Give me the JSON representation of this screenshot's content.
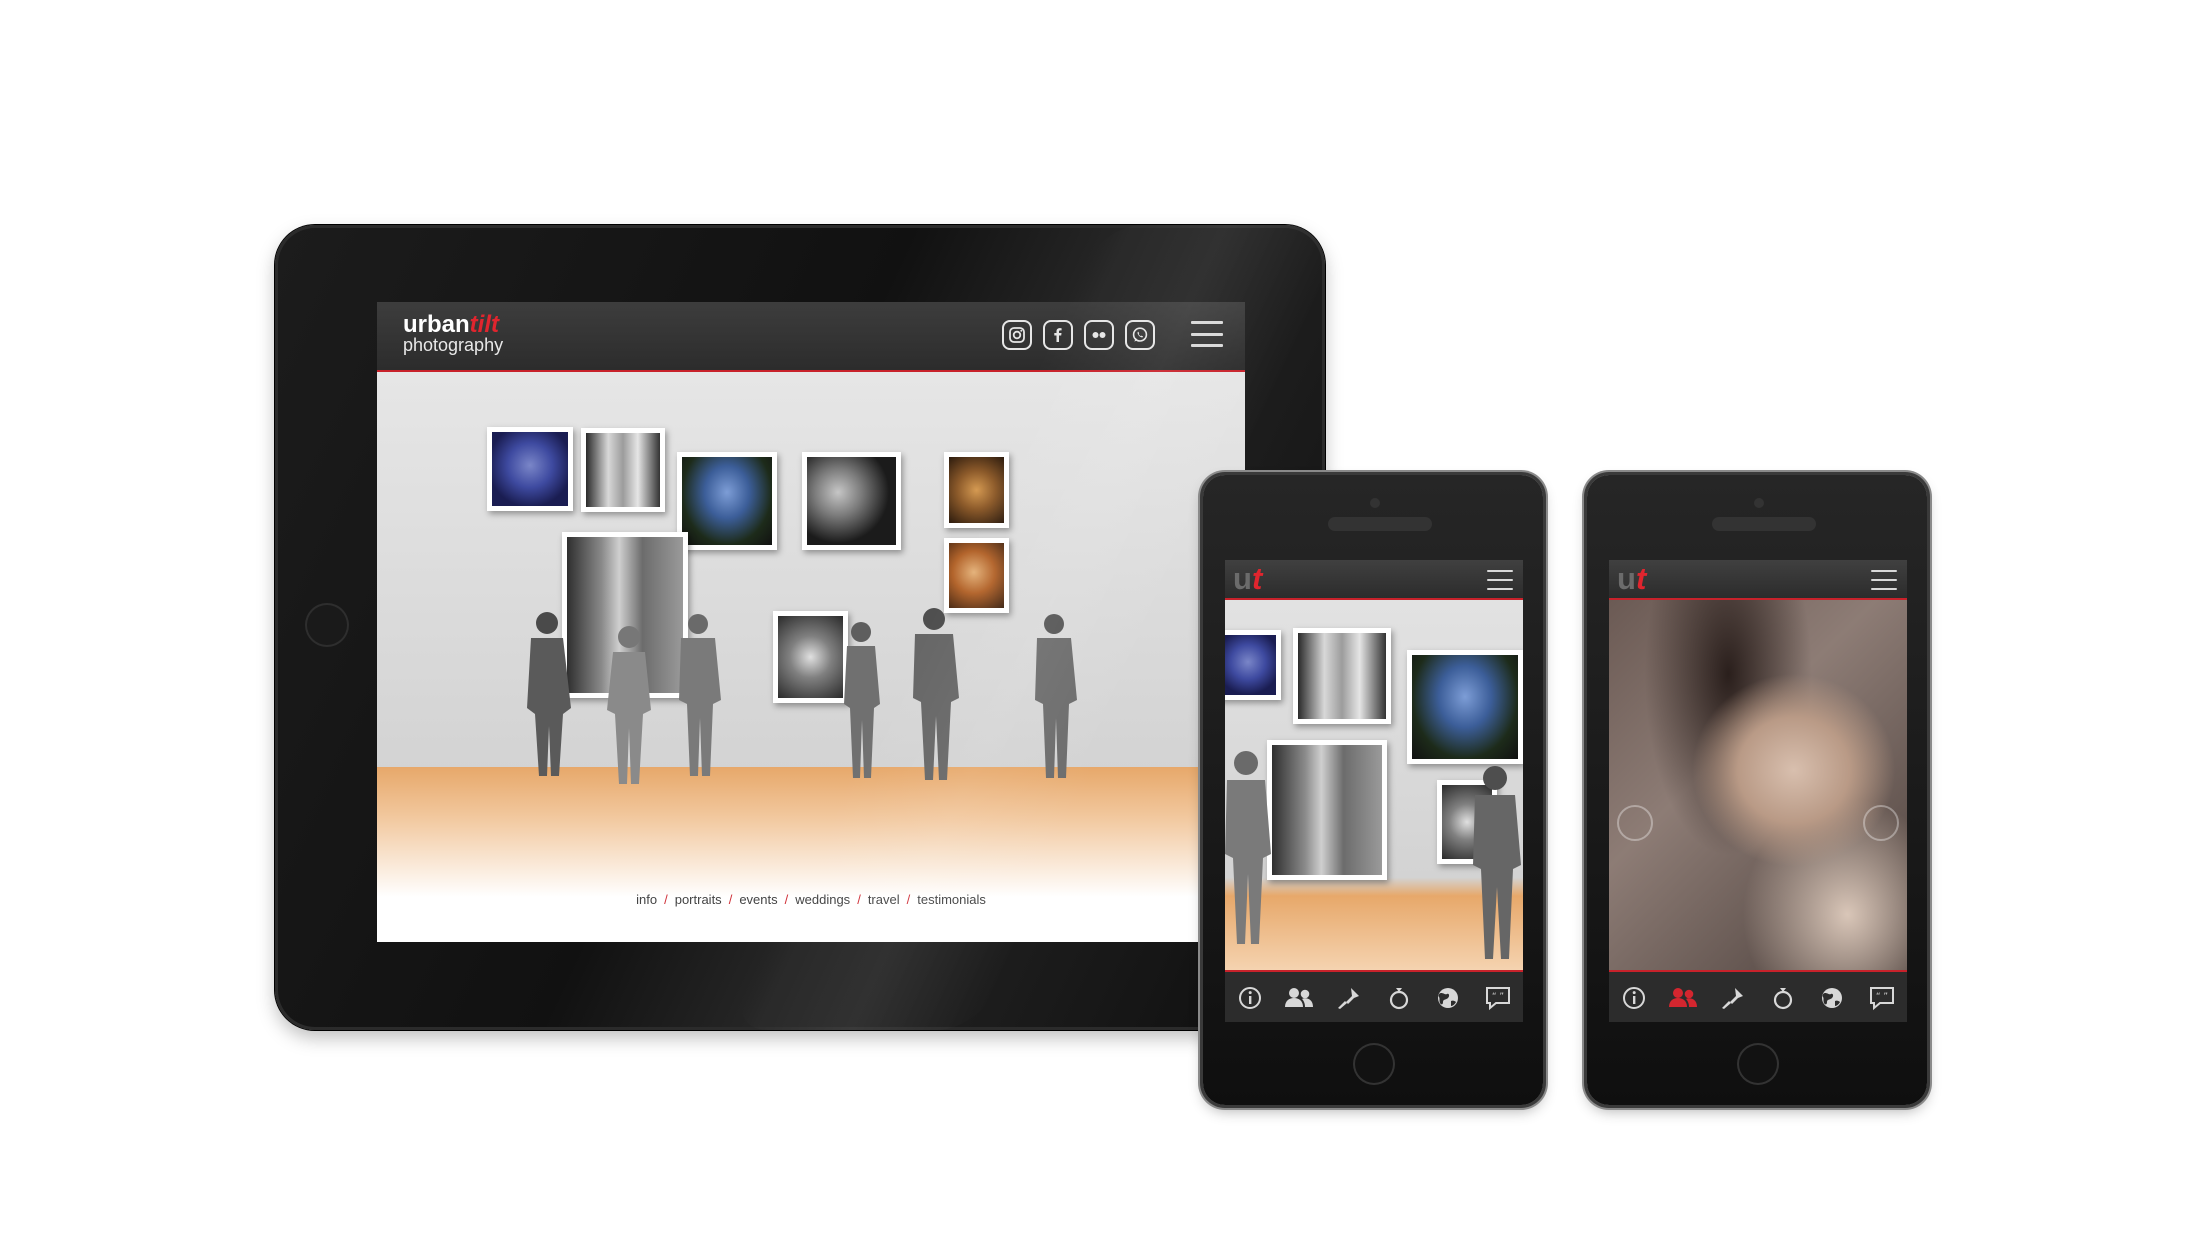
{
  "tablet": {
    "logo": {
      "word1": "urban",
      "word2": "tilt",
      "word3": "photography"
    },
    "social": [
      "instagram-icon",
      "facebook-icon",
      "flickr-icon",
      "whatsapp-icon"
    ],
    "nav": [
      "info",
      "portraits",
      "events",
      "weddings",
      "travel",
      "testimonials"
    ],
    "nav_separator": "/"
  },
  "phone": {
    "logo": {
      "u": "u",
      "t": "t"
    },
    "tabs": [
      "info-icon",
      "people-icon",
      "flashlight-icon",
      "ring-icon",
      "globe-icon",
      "quote-icon"
    ],
    "phone1_active_tab": "",
    "phone2_active_tab": "people-icon"
  },
  "colors": {
    "accent": "#c8222b",
    "header": "#333333",
    "floor": "#e7a86a"
  }
}
